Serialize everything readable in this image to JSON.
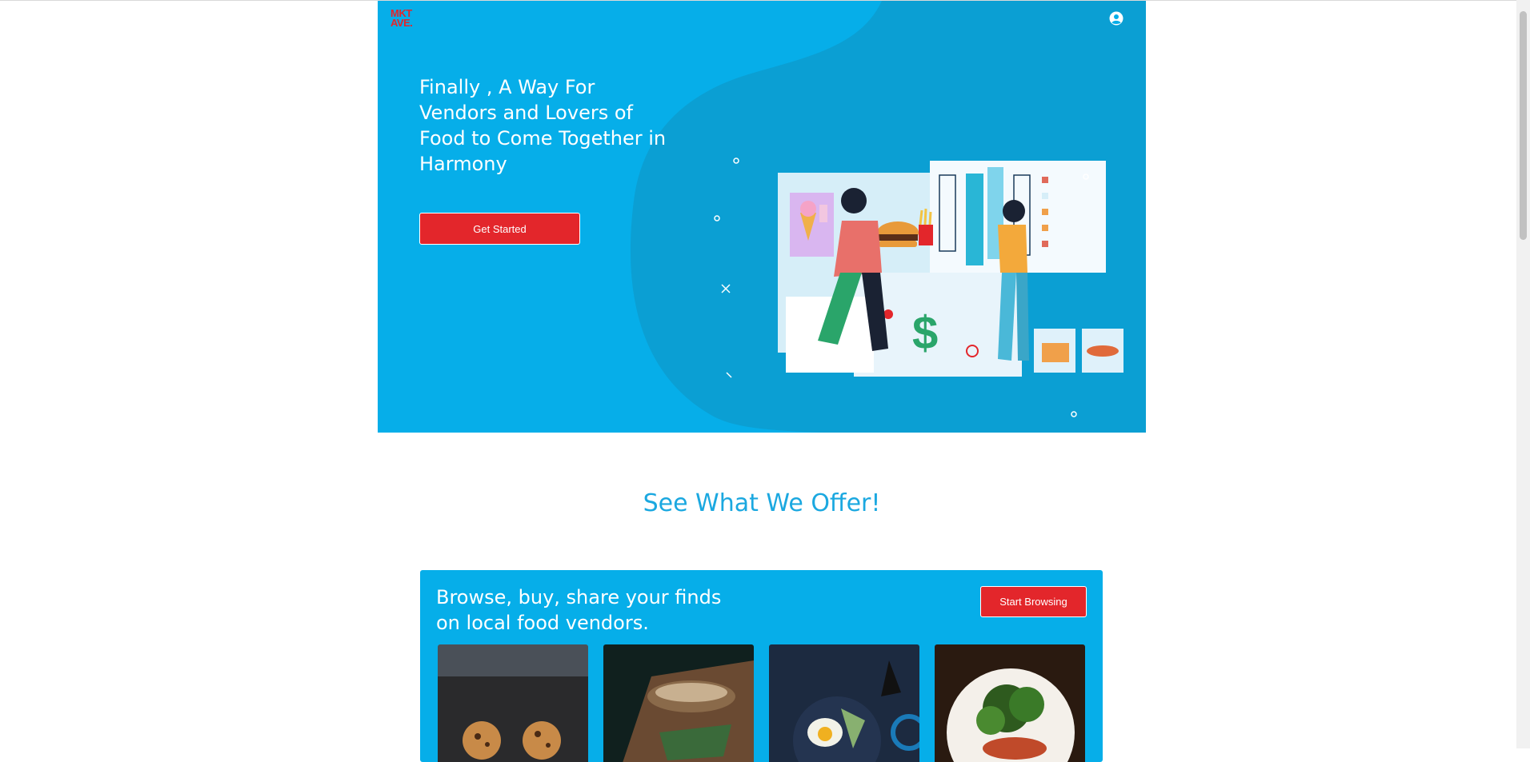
{
  "header": {
    "logo_line1": "MKT",
    "logo_line2": "AVE.",
    "account_icon": "user-circle-icon"
  },
  "hero": {
    "headline": "Finally , A Way For Vendors and Lovers of Food to Come Together in Harmony",
    "cta_label": "Get Started",
    "illustration": "vendor-customer-illustration"
  },
  "offer": {
    "section_title": "See What We Offer!",
    "tagline": "Browse, buy, share your finds on local food vendors.",
    "cta_label": "Start Browsing",
    "cards": [
      "cookies",
      "grilled-toast",
      "egg-bowl",
      "salad-plate"
    ]
  },
  "colors": {
    "brand_blue": "#06aee9",
    "accent_red": "#e3262b",
    "title_blue": "#1ba8e0"
  }
}
